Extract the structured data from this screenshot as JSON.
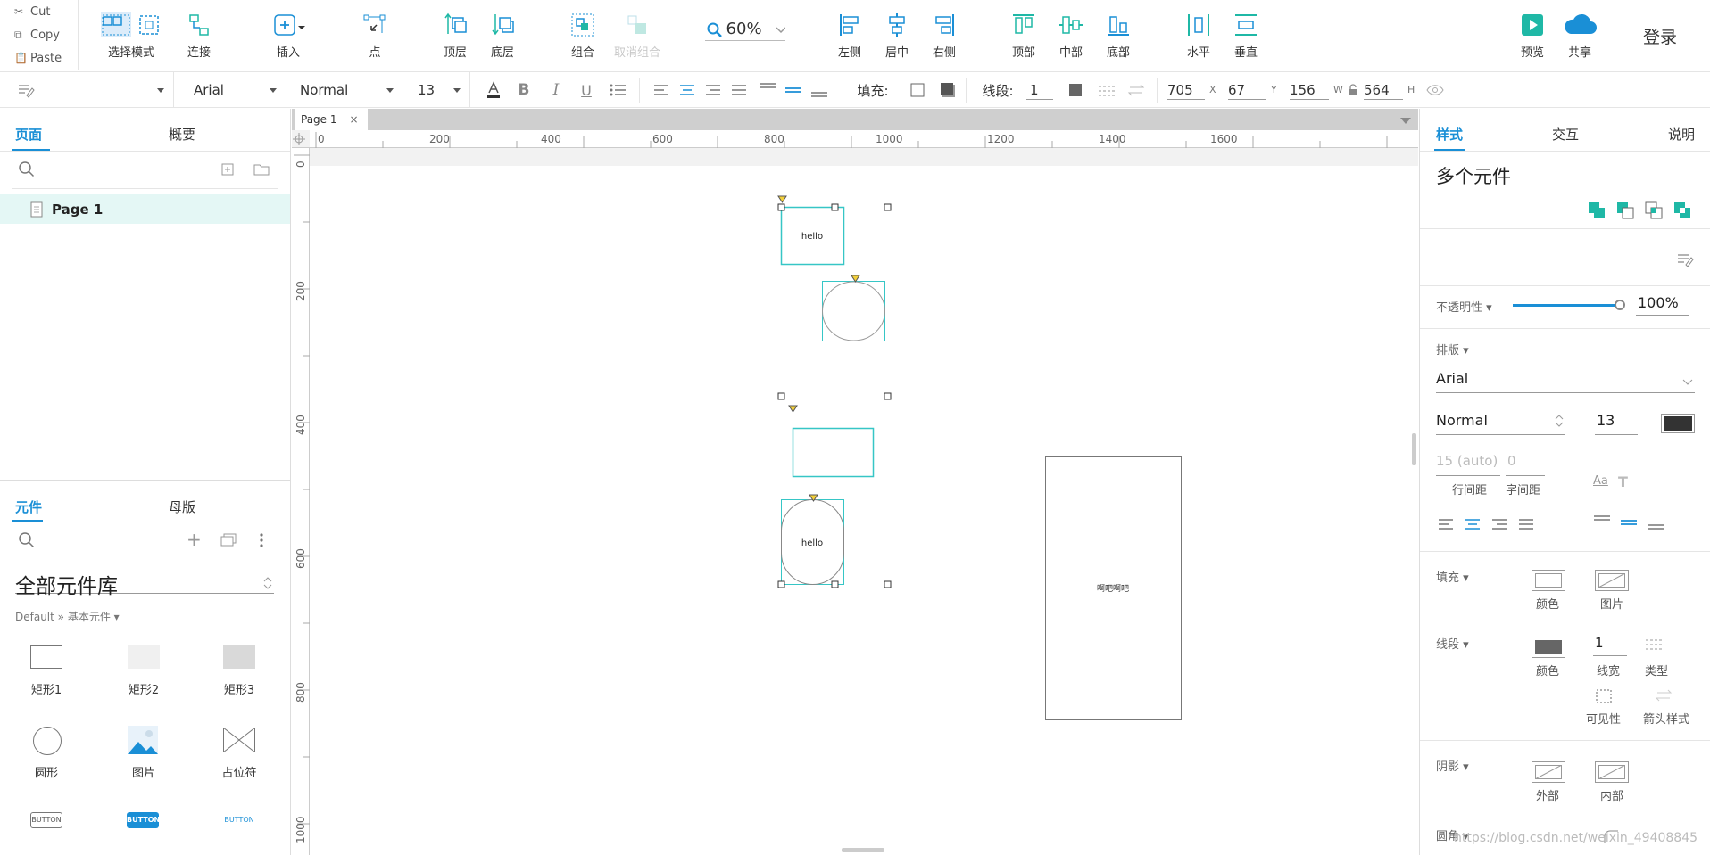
{
  "clipboard": {
    "cut": "Cut",
    "copy": "Copy",
    "paste": "Paste"
  },
  "toolbar": {
    "select_mode": "选择模式",
    "connect": "连接",
    "insert": "插入",
    "point": "点",
    "top_layer": "顶层",
    "bottom_layer": "底层",
    "group": "组合",
    "ungroup": "取消组合",
    "zoom": "60%",
    "align_left": "左侧",
    "align_center": "居中",
    "align_right": "右侧",
    "align_top": "顶部",
    "align_middle": "中部",
    "align_bottom": "底部",
    "dist_h": "水平",
    "dist_v": "垂直",
    "preview": "预览",
    "share": "共享",
    "login": "登录"
  },
  "format": {
    "font": "Arial",
    "weight": "Normal",
    "size": "13",
    "fill_label": "填充:",
    "stroke_label": "线段:",
    "stroke_width": "1",
    "x": "705",
    "y": "67",
    "w": "156",
    "h": "564",
    "x_suffix": "X",
    "y_suffix": "Y",
    "w_suffix": "W",
    "h_suffix": "H"
  },
  "left": {
    "tabs": [
      "页面",
      "概要"
    ],
    "page_item": "Page 1",
    "lib_tabs": [
      "元件",
      "母版"
    ],
    "library_title": "全部元件库",
    "library_path": "Default » 基本元件 ▾",
    "widgets": [
      "矩形1",
      "矩形2",
      "矩形3",
      "圆形",
      "图片",
      "占位符"
    ],
    "button_texts": [
      "BUTTON",
      "BUTTON",
      "BUTTON"
    ]
  },
  "canvas": {
    "tab_label": "Page 1",
    "ruler_h": [
      "0",
      "200",
      "400",
      "600",
      "800",
      "1000",
      "1200",
      "1400",
      "1600"
    ],
    "ruler_v": [
      "0",
      "200",
      "400",
      "600",
      "800",
      "1000"
    ],
    "shape_hello_1": "hello",
    "shape_hello_2": "hello",
    "big_rect_text": "啊吧啊吧"
  },
  "right": {
    "tabs": [
      "样式",
      "交互",
      "说明"
    ],
    "title": "多个元件",
    "opacity_label": "不透明性 ▾",
    "opacity_value": "100%",
    "opacity": 1.0,
    "typo_label": "排版 ▾",
    "font": "Arial",
    "weight": "Normal",
    "size": "13",
    "line_spacing": "15 (auto)",
    "char_spacing": "0",
    "line_spacing_label": "行间距",
    "char_spacing_label": "字间距",
    "fill_label": "填充 ▾",
    "fill_color": "颜色",
    "fill_image": "图片",
    "stroke_label": "线段 ▾",
    "stroke_color": "颜色",
    "stroke_width": "1",
    "stroke_width_label": "线宽",
    "stroke_type": "类型",
    "visibility": "可见性",
    "arrow_style": "箭头样式",
    "shadow_label": "阴影 ▾",
    "shadow_outer": "外部",
    "shadow_inner": "内部",
    "corner_label": "圆角 ▾",
    "watermark": "https://blog.csdn.net/weixin_49408845"
  },
  "colors": {
    "accent": "#1a8fd6",
    "teal": "#1fb8a6",
    "selection": "#36c6c6"
  }
}
